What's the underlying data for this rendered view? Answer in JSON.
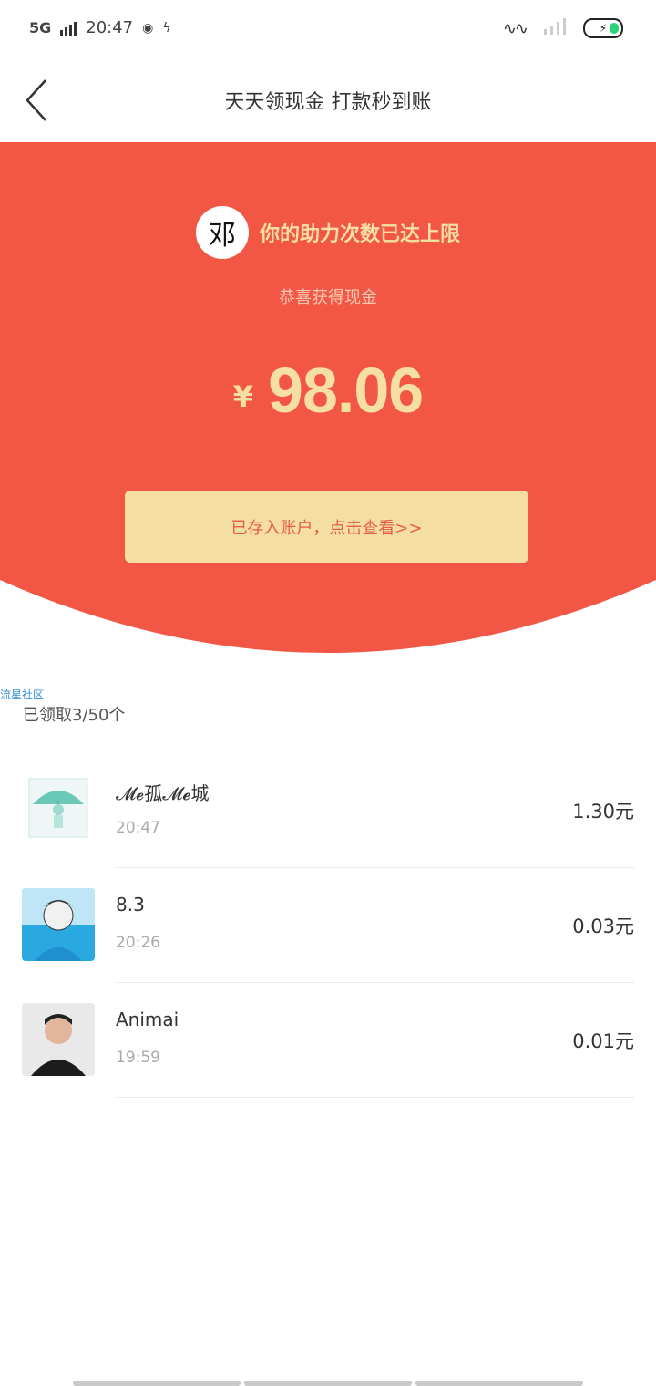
{
  "status_bar": {
    "network": "5G",
    "time": "20:47"
  },
  "header": {
    "title": "天天领现金  打款秒到账"
  },
  "hero": {
    "logo_char": "邓",
    "limit_text": "你的助力次数已达上限",
    "congrats_text": "恭喜获得现金",
    "currency": "¥",
    "amount": "98.06",
    "button_label": "已存入账户，点击查看>>",
    "colors": {
      "hero_background": "#f25746",
      "gold_text": "#f6dfa2",
      "button_background": "#f4dea1",
      "button_text": "#e55c45"
    }
  },
  "community_tag": "流星社区",
  "received_count": "已领取3/50个",
  "list": {
    "items": [
      {
        "name": "𝓜𝓮孤𝓜𝓮城",
        "time": "20:47",
        "amount": "1.30元",
        "avatar": "umbrella-girl-avatar"
      },
      {
        "name": "8.3",
        "time": "20:26",
        "amount": "0.03元",
        "avatar": "anime-boy-avatar"
      },
      {
        "name": "Animai",
        "time": "19:59",
        "amount": "0.01元",
        "avatar": "man-photo-avatar"
      }
    ]
  }
}
